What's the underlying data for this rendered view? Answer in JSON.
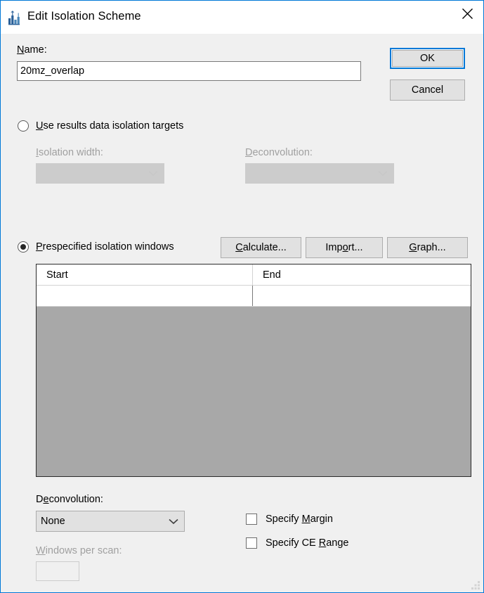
{
  "window": {
    "title": "Edit Isolation Scheme",
    "icon": "skyline-chart-icon",
    "close_label": "×",
    "accent_color": "#0078d7",
    "background_color": "#f0f0f0",
    "grid_background_color": "#a8a8a8"
  },
  "name_field": {
    "label_before": "N",
    "label_accel": "N",
    "label": "Name:",
    "value": "20mz_overlap"
  },
  "buttons": {
    "ok": "OK",
    "cancel": "Cancel",
    "calculate": "Calculate...",
    "import": "Import...",
    "graph": "Graph..."
  },
  "options": {
    "use_results": {
      "label": "Use results data isolation targets",
      "selected": false
    },
    "prespecified": {
      "label": "Prespecified isolation windows",
      "selected": true
    }
  },
  "results_fields": {
    "isolation_width": {
      "label": "Isolation width:",
      "value": "",
      "enabled": false
    },
    "deconvolution": {
      "label": "Deconvolution:",
      "value": "",
      "enabled": false
    }
  },
  "grid": {
    "columns": [
      "Start",
      "End"
    ],
    "rows": [
      {
        "start": "",
        "end": ""
      }
    ]
  },
  "bottom": {
    "deconvolution": {
      "label": "Deconvolution:",
      "value": "None",
      "enabled": true
    },
    "windows_per_scan": {
      "label": "Windows per scan:",
      "value": "",
      "enabled": false
    },
    "specify_margin": {
      "label": "Specify Margin",
      "checked": false
    },
    "specify_ce_range": {
      "label": "Specify CE Range",
      "checked": false
    }
  }
}
